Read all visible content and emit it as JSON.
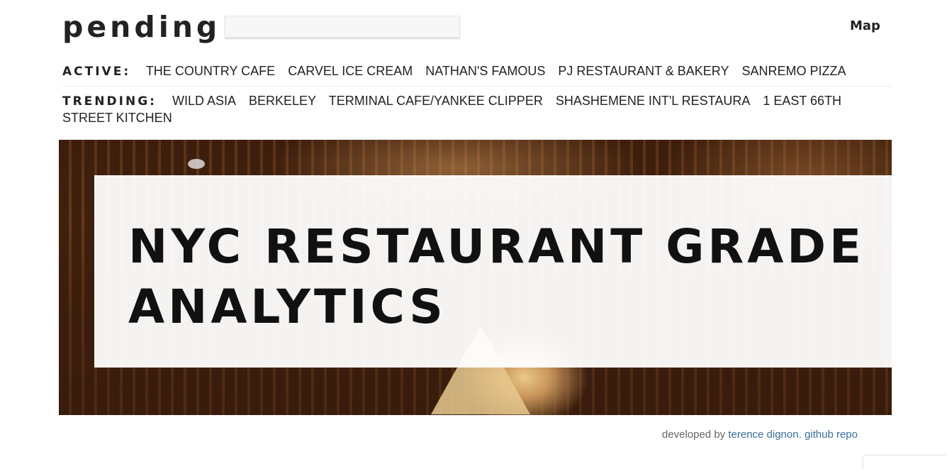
{
  "header": {
    "logo": "pending",
    "search_placeholder": "",
    "map_label": "Map"
  },
  "active": {
    "label": "ACTIVE:",
    "items": [
      "THE COUNTRY CAFE",
      "CARVEL ICE CREAM",
      "NATHAN'S FAMOUS",
      "PJ RESTAURANT & BAKERY",
      "SANREMO PIZZA"
    ]
  },
  "trending": {
    "label": "TRENDING:",
    "items": [
      "WILD ASIA",
      "BERKELEY",
      "TERMINAL CAFE/YANKEE CLIPPER",
      "SHASHEMENE INT'L RESTAURA",
      "1 EAST 66TH STREET KITCHEN"
    ]
  },
  "hero": {
    "title": "NYC RESTAURANT GRADE ANALYTICS"
  },
  "footer": {
    "prefix": "developed by",
    "author": "terence dignon.",
    "repo": "github repo"
  },
  "colors": {
    "text": "#222222",
    "link": "#3a6ea5",
    "footer_text": "#666666"
  }
}
